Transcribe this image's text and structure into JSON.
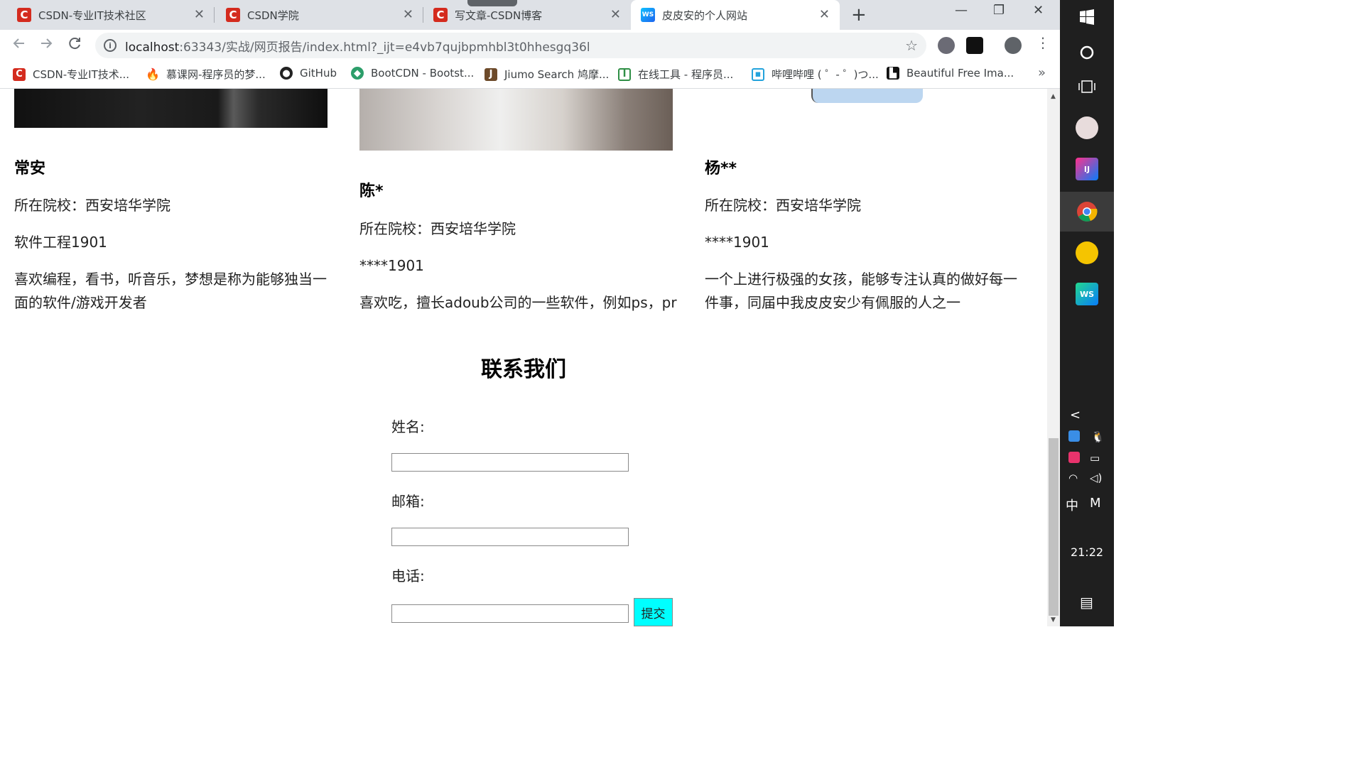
{
  "tabs": [
    {
      "title": "CSDN-专业IT技术社区",
      "icon": "csdn-icon"
    },
    {
      "title": "CSDN学院",
      "icon": "csdn-icon"
    },
    {
      "title": "写文章-CSDN博客",
      "icon": "csdn-icon"
    },
    {
      "title": "皮皮安的个人网站",
      "icon": "webstorm-icon",
      "active": true
    }
  ],
  "tab_close": "✕",
  "new_tab": "+",
  "window_controls": {
    "minimize": "—",
    "restore": "❐",
    "close": "✕"
  },
  "address": {
    "host": "localhost",
    "path": ":63343/实战/网页报告/index.html?_ijt=e4vb7qujbpmhbl3t0hhesgq36l"
  },
  "bookmarks": [
    {
      "label": "CSDN-专业IT技术...",
      "icon": "csdn-icon"
    },
    {
      "label": "慕课网-程序员的梦...",
      "icon": "flame-icon"
    },
    {
      "label": "GitHub",
      "icon": "github-icon"
    },
    {
      "label": "BootCDN - Bootst...",
      "icon": "bootcdn-icon"
    },
    {
      "label": "Jiumo Search 鸠摩...",
      "icon": "jiumo-icon"
    },
    {
      "label": "在线工具 - 程序员...",
      "icon": "tool-icon"
    },
    {
      "label": "哔哩哔哩 ( ゜- ゜)つ...",
      "icon": "bilibili-icon"
    },
    {
      "label": "Beautiful Free Ima...",
      "icon": "unsplash-icon"
    }
  ],
  "bookmarks_more": "»",
  "members": [
    {
      "name": "常安",
      "school": "所在院校：西安培华学院",
      "class": "软件工程1901",
      "bio": "喜欢编程，看书，听音乐，梦想是称为能够独当一面的软件/游戏开发者"
    },
    {
      "name": "陈*",
      "school": "所在院校：西安培华学院",
      "class": "****1901",
      "bio": "喜欢吃，擅长adoub公司的一些软件，例如ps，pr"
    },
    {
      "name": "杨**",
      "school": "所在院校：西安培华学院",
      "class": "****1901",
      "bio": "一个上进行极强的女孩，能够专注认真的做好每一件事，同届中我皮皮安少有佩服的人之一"
    }
  ],
  "contact": {
    "title": "联系我们",
    "name_label": "姓名:",
    "email_label": "邮箱:",
    "phone_label": "电话:",
    "submit": "提交"
  },
  "taskbar": {
    "clock": "21:22",
    "ime": "中",
    "ime2": "M",
    "tray_arrow": "<"
  },
  "colors": {
    "tabbar": "#dee1e6",
    "csdn_red": "#d42b1e",
    "submit_bg": "#00ffff",
    "taskbar": "#1f1f1f"
  }
}
